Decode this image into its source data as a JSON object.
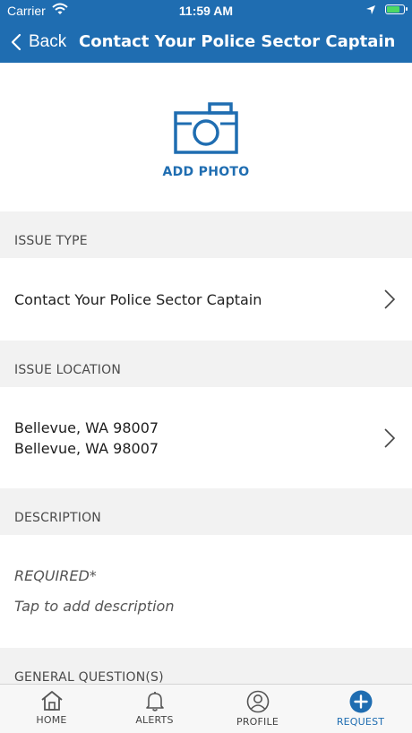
{
  "status": {
    "carrier": "Carrier",
    "time": "11:59 AM"
  },
  "nav": {
    "back_label": "Back",
    "title": "Contact Your Police Sector Captain"
  },
  "photo": {
    "label": "ADD PHOTO"
  },
  "issue_type": {
    "header": "ISSUE TYPE",
    "value": "Contact Your Police Sector Captain"
  },
  "issue_location": {
    "header": "ISSUE LOCATION",
    "line1": "Bellevue, WA  98007",
    "line2": "Bellevue, WA  98007"
  },
  "description": {
    "header": "DESCRIPTION",
    "required": "REQUIRED*",
    "placeholder": "Tap to add description"
  },
  "general_questions": {
    "header": "GENERAL QUESTION(S)"
  },
  "tabs": [
    {
      "label": "HOME",
      "icon": "home-icon"
    },
    {
      "label": "ALERTS",
      "icon": "bell-icon"
    },
    {
      "label": "PROFILE",
      "icon": "user-icon"
    },
    {
      "label": "REQUEST",
      "icon": "plus-circle-icon"
    }
  ],
  "colors": {
    "brand": "#1f6db1",
    "section_bg": "#f2f2f2",
    "battery": "#4cd964"
  }
}
